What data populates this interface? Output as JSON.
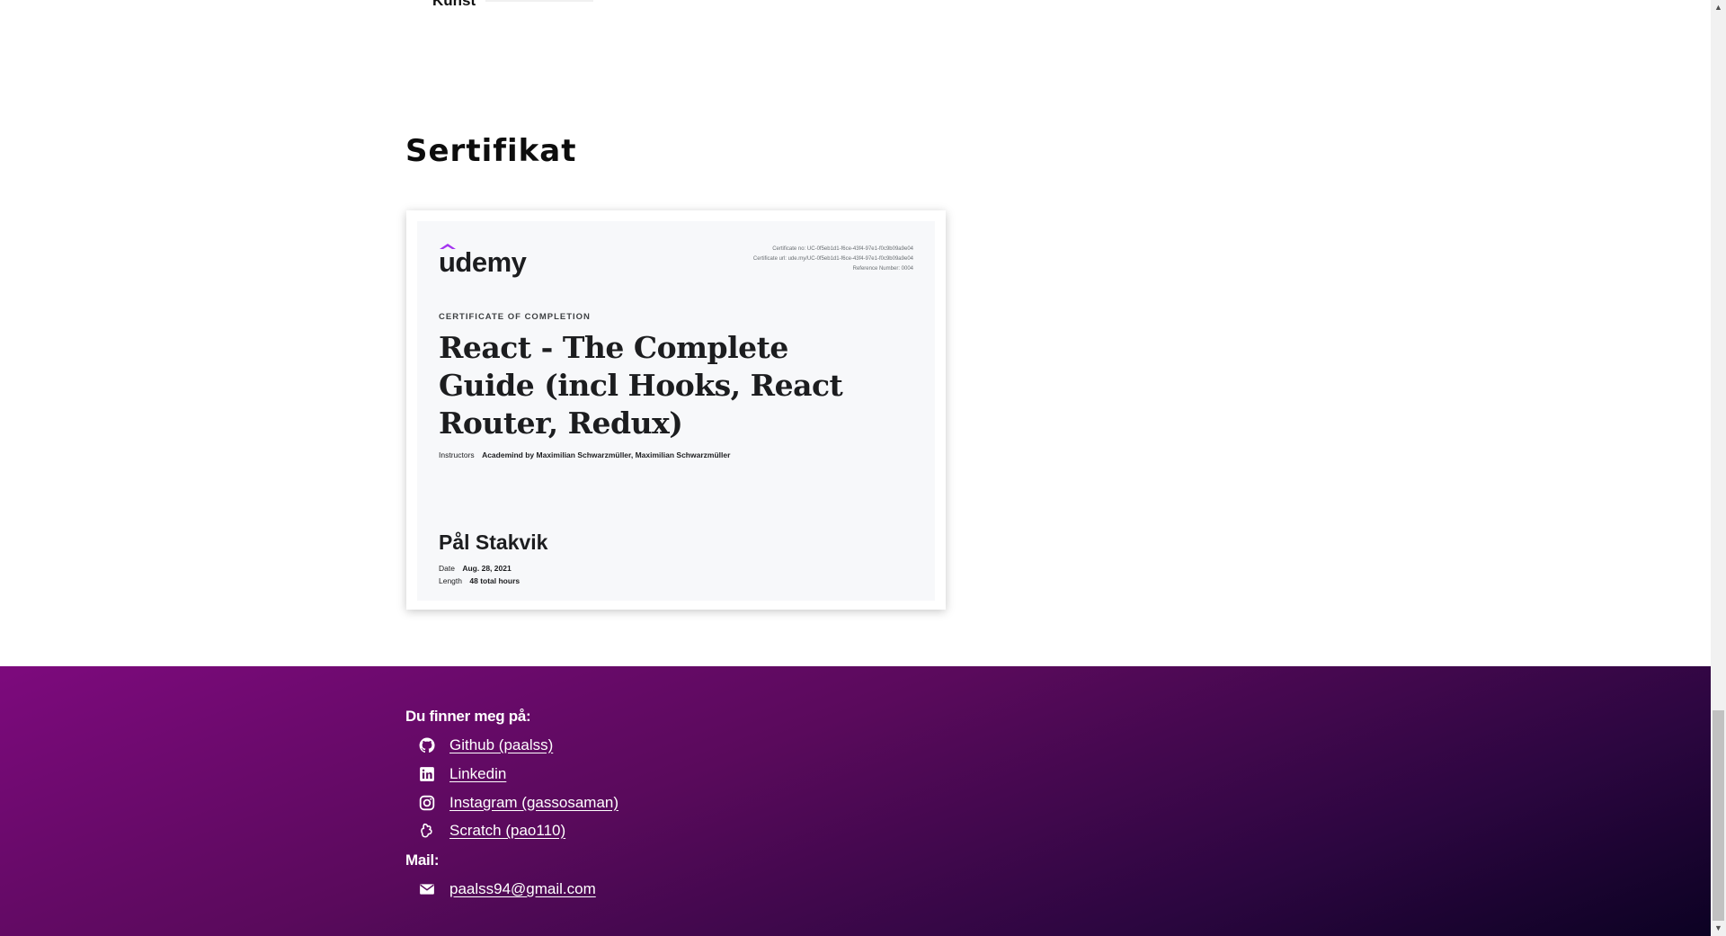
{
  "prev_section": {
    "item_label": "Kunst"
  },
  "certificates": {
    "title": "Sertifikat",
    "card": {
      "brand": "udemy",
      "brand_color": "#a435f0",
      "meta": [
        "Certificate no: UC-0f5eb1d1-f6ce-43f4-97e1-f0c9b09a9e04",
        "Certificate url: ude.my/UC-0f5eb1d1-f6ce-43f4-97e1-f0c9b09a9e04",
        "Reference Number: 0004"
      ],
      "kicker": "CERTIFICATE OF COMPLETION",
      "course": "React - The Complete Guide (incl Hooks, React Router, Redux)",
      "instructors_label": "Instructors",
      "instructors": "Academind by Maximilian Schwarzmüller,  Maximilian Schwarzmüller",
      "name": "Pål Stakvik",
      "date_label": "Date",
      "date": "Aug. 28, 2021",
      "length_label": "Length",
      "length": "48 total hours"
    }
  },
  "footer": {
    "find_heading": "Du finner meg på:",
    "links": [
      {
        "icon": "github-icon",
        "label": "Github (paalss)"
      },
      {
        "icon": "linkedin-icon",
        "label": "Linkedin"
      },
      {
        "icon": "instagram-icon",
        "label": "Instagram (gassosaman)"
      },
      {
        "icon": "scratch-icon",
        "label": "Scratch (pao110)"
      }
    ],
    "mail_heading": "Mail:",
    "mail": {
      "icon": "envelope-icon",
      "label": "paalss94@gmail.com"
    },
    "gradient_colors": [
      "#7d0a7d",
      "#0c0223"
    ]
  }
}
